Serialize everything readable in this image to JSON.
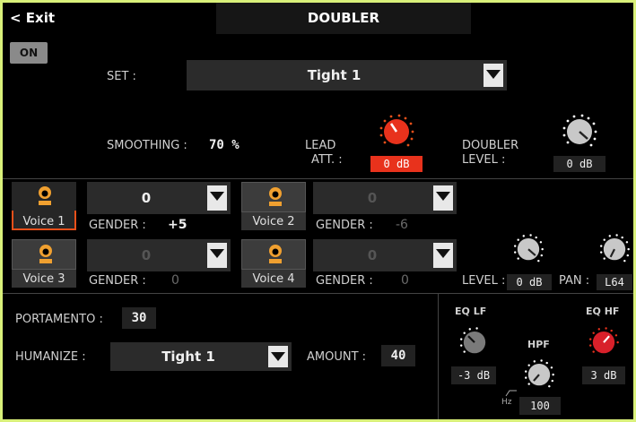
{
  "header": {
    "exit_label": "< Exit",
    "title": "DOUBLER"
  },
  "on_button": "ON",
  "set": {
    "label": "SET :",
    "value": "Tight 1"
  },
  "smoothing": {
    "label": "SMOOTHING :",
    "value": "70 %"
  },
  "lead_att": {
    "label_line1": "LEAD",
    "label_line2": "ATT. :",
    "value": "0 dB",
    "color": "#e8321c"
  },
  "doubler_level": {
    "label_line1": "DOUBLER",
    "label_line2": "LEVEL :",
    "value": "0 dB"
  },
  "voices": [
    {
      "name": "Voice 1",
      "value": "0",
      "gender_label": "GENDER :",
      "gender": "+5",
      "enabled": true
    },
    {
      "name": "Voice 2",
      "value": "0",
      "gender_label": "GENDER :",
      "gender": "-6",
      "enabled": false
    },
    {
      "name": "Voice 3",
      "value": "0",
      "gender_label": "GENDER :",
      "gender": "0",
      "enabled": false
    },
    {
      "name": "Voice 4",
      "value": "0",
      "gender_label": "GENDER :",
      "gender": "0",
      "enabled": false
    }
  ],
  "level": {
    "label": "LEVEL :",
    "value": "0 dB"
  },
  "pan": {
    "label": "PAN :",
    "value": "L64"
  },
  "portamento": {
    "label": "PORTAMENTO :",
    "value": "30"
  },
  "humanize": {
    "label": "HUMANIZE :",
    "value": "Tight 1"
  },
  "amount": {
    "label": "AMOUNT :",
    "value": "40"
  },
  "eq_lf": {
    "label": "EQ LF",
    "value": "-3 dB"
  },
  "hpf": {
    "label": "HPF",
    "unit": "Hz",
    "value": "100"
  },
  "eq_hf": {
    "label": "EQ HF",
    "value": "3 dB",
    "color": "#d8202a"
  },
  "colors": {
    "accent": "#e8321c",
    "frame": "#d9f07a",
    "voice_icon": "#f0a030"
  }
}
